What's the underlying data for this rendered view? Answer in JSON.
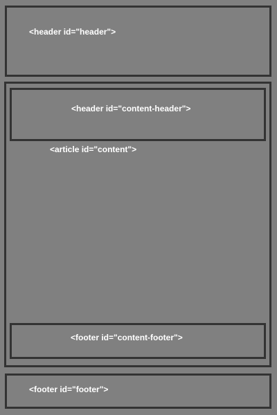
{
  "labels": {
    "header": "<header id=\"header\">",
    "main": "<article id=\"content\">",
    "content_header": "<header id=\"content-header\">",
    "content_footer": "<footer id=\"content-footer\">",
    "footer": "<footer id=\"footer\">"
  },
  "colors": {
    "background": "#808080",
    "border": "#333333",
    "text": "#ffffff"
  }
}
